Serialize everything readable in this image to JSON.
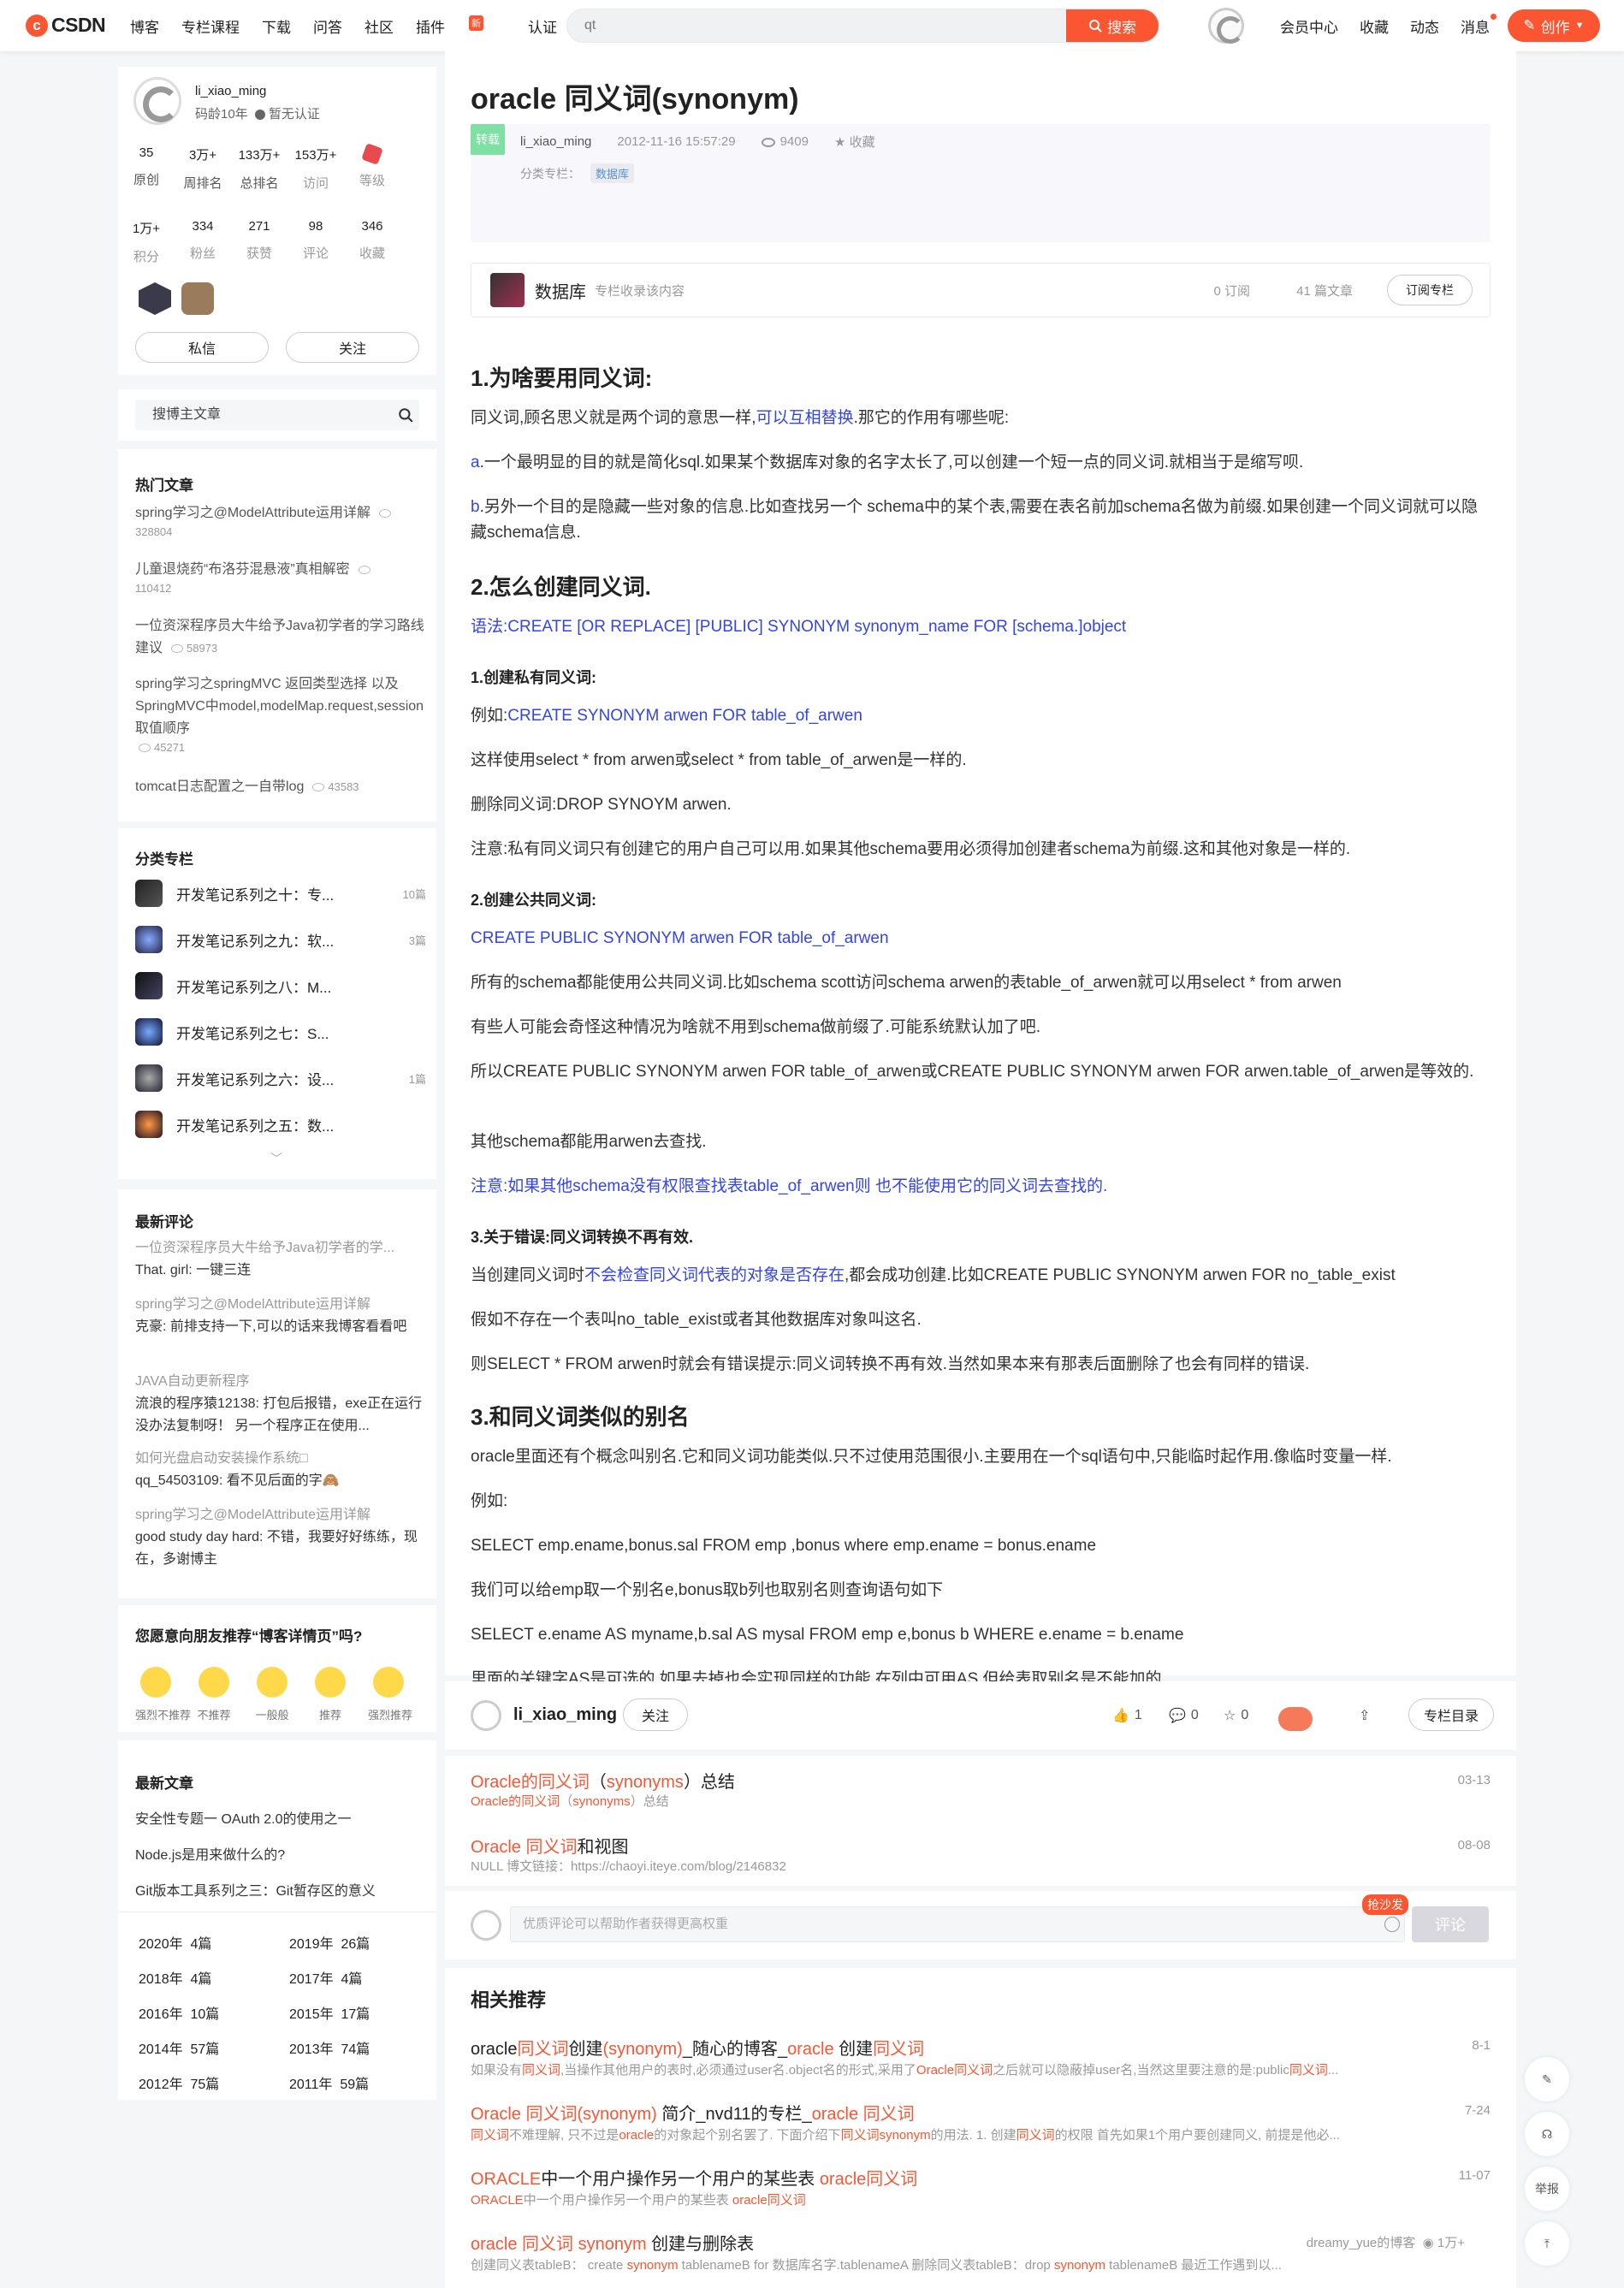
{
  "topbar": {
    "logo": "CSDN",
    "nav": [
      "博客",
      "专栏课程",
      "下载",
      "问答",
      "社区",
      "插件",
      "认证"
    ],
    "plugin_badge": "新",
    "search_value": "qt",
    "search_btn": "搜索",
    "right": [
      "会员中心",
      "收藏",
      "动态",
      "消息"
    ],
    "create": "创作"
  },
  "profile": {
    "name": "li_xiao_ming",
    "age": "码龄10年",
    "verify": "暂无认证",
    "stats1": [
      {
        "v": "35",
        "l": "原创"
      },
      {
        "v": "3万+",
        "l": "周排名"
      },
      {
        "v": "133万+",
        "l": "总排名"
      },
      {
        "v": "153万+",
        "l": "访问"
      },
      {
        "v": "",
        "l": "等级"
      }
    ],
    "stats2": [
      {
        "v": "1万+",
        "l": "积分"
      },
      {
        "v": "334",
        "l": "粉丝"
      },
      {
        "v": "271",
        "l": "获赞"
      },
      {
        "v": "98",
        "l": "评论"
      },
      {
        "v": "346",
        "l": "收藏"
      }
    ],
    "msg": "私信",
    "follow": "关注"
  },
  "sidesearch": {
    "placeholder": "搜博主文章"
  },
  "hot": {
    "title": "热门文章",
    "items": [
      {
        "t": "spring学习之@ModelAttribute运用详解",
        "v": "328804"
      },
      {
        "t": "儿童退烧药“布洛芬混悬液”真相解密",
        "v": "110412"
      },
      {
        "t": "一位资深程序员大牛给予Java初学者的学习路线建议",
        "v": "58973"
      },
      {
        "t": "spring学习之springMVC 返回类型选择 以及 SpringMVC中model,modelMap.request,session取值顺序",
        "v": "45271"
      },
      {
        "t": "tomcat日志配置之一自带log",
        "v": "43583"
      }
    ]
  },
  "columns": {
    "title": "分类专栏",
    "items": [
      {
        "n": "开发笔记系列之十：专...",
        "c": "10篇"
      },
      {
        "n": "开发笔记系列之九：软...",
        "c": "3篇"
      },
      {
        "n": "开发笔记系列之八：M...",
        "c": ""
      },
      {
        "n": "开发笔记系列之七：S...",
        "c": ""
      },
      {
        "n": "开发笔记系列之六：设...",
        "c": "1篇"
      },
      {
        "n": "开发笔记系列之五：数...",
        "c": ""
      }
    ]
  },
  "comments": {
    "title": "最新评论",
    "items": [
      {
        "a": "一位资深程序员大牛给予Java初学者的学...",
        "b": "That. girl: 一键三连"
      },
      {
        "a": "spring学习之@ModelAttribute运用详解",
        "b": "克豪: 前排支持一下,可以的话来我博客看看吧"
      },
      {
        "a": "JAVA自动更新程序",
        "b": "流浪的程序猿12138: 打包后报错，exe正在运行没办法复制呀！ 另一个程序正在使用..."
      },
      {
        "a": "如何光盘启动安装操作系统□",
        "b": "qq_54503109: 看不见后面的字🙈"
      },
      {
        "a": "spring学习之@ModelAttribute运用详解",
        "b": "good study day hard: 不错，我要好好练练，现在，多谢博主"
      }
    ]
  },
  "recommend": {
    "title": "您愿意向朋友推荐“博客详情页”吗?",
    "faces": [
      "强烈不推荐",
      "不推荐",
      "一般般",
      "推荐",
      "强烈推荐"
    ]
  },
  "latest": {
    "title": "最新文章",
    "items": [
      "安全性专题一 OAuth 2.0的使用之一",
      "Node.js是用来做什么的?",
      "Git版本工具系列之三：Git暂存区的意义"
    ]
  },
  "archive": [
    {
      "y": "2020年",
      "c": "4篇"
    },
    {
      "y": "2019年",
      "c": "26篇"
    },
    {
      "y": "2018年",
      "c": "4篇"
    },
    {
      "y": "2017年",
      "c": "4篇"
    },
    {
      "y": "2016年",
      "c": "10篇"
    },
    {
      "y": "2015年",
      "c": "17篇"
    },
    {
      "y": "2014年",
      "c": "57篇"
    },
    {
      "y": "2013年",
      "c": "74篇"
    },
    {
      "y": "2012年",
      "c": "75篇"
    },
    {
      "y": "2011年",
      "c": "59篇"
    }
  ],
  "article": {
    "title": "oracle 同义词(synonym)",
    "tag": "转载",
    "author": "li_xiao_ming",
    "date": "2012-11-16 15:57:29",
    "views": "9409",
    "fav": "收藏",
    "cat_label": "分类专栏：",
    "cat": "数据库",
    "column": {
      "name": "数据库",
      "desc": "专栏收录该内容",
      "subs": "0 订阅",
      "count": "41 篇文章",
      "btn": "订阅专栏"
    }
  },
  "content": {
    "h1": "1.为啥要用同义词:",
    "p1a": "同义词,顾名思义就是两个词的意思一样,",
    "p1b": "可以互相替换",
    "p1c": ".那它的作用有哪些呢:",
    "p2a": "a",
    "p2b": ".一个最明显的目的就是简化sql.如果某个数据库对象的名字太长了,可以创建一个短一点的同义词.就相当于是缩写呗.",
    "p3a": "b",
    "p3b": ".另外一个目的是隐藏一些对象的信息.比如查找另一个 schema中的某个表,需要在表名前加schema名做为前缀.如果创建一个同义词就可以隐藏schema信息.",
    "h2": "2.怎么创建同义词.",
    "p4": "语法:CREATE [OR REPLACE] [PUBLIC] SYNONYM synonym_name FOR [schema.]object",
    "h3": "1.创建私有同义词:",
    "p5a": "例如:",
    "p5b": "CREATE SYNONYM arwen FOR table_of_arwen",
    "p6": "这样使用select * from arwen或select * from table_of_arwen是一样的.",
    "p7": "删除同义词:DROP SYNOYM arwen.",
    "p8": "注意:私有同义词只有创建它的用户自己可以用.如果其他schema要用必须得加创建者schema为前缀.这和其他对象是一样的.",
    "h4": "2.创建公共同义词:",
    "p9": "CREATE PUBLIC SYNONYM arwen FOR table_of_arwen",
    "p10": "所有的schema都能使用公共同义词.比如schema scott访问schema arwen的表table_of_arwen就可以用select * from arwen",
    "p11": "有些人可能会奇怪这种情况为啥就不用到schema做前缀了.可能系统默认加了吧.",
    "p12": "所以CREATE PUBLIC SYNONYM arwen FOR table_of_arwen或CREATE PUBLIC SYNONYM arwen FOR arwen.table_of_arwen是等效的.",
    "p13": "其他schema都能用arwen去查找.",
    "p14": "注意:如果其他schema没有权限查找表table_of_arwen则 也不能使用它的同义词去查找的.",
    "h5": "3.关于错误:同义词转换不再有效.",
    "p15a": "当创建同义词时",
    "p15b": "不会检查同义词代表的对象是否存在",
    "p15c": ",都会成功创建.比如CREATE PUBLIC SYNONYM arwen FOR no_table_exist",
    "p16": "假如不存在一个表叫no_table_exist或者其他数据库对象叫这名.",
    "p17": "则SELECT * FROM arwen时就会有错误提示:同义词转换不再有效.当然如果本来有那表后面删除了也会有同样的错误.",
    "h6": "3.和同义词类似的别名",
    "p18": "oracle里面还有个概念叫别名.它和同义词功能类似.只不过使用范围很小.主要用在一个sql语句中,只能临时起作用.像临时变量一样.",
    "p19": "例如:",
    "p20": "SELECT emp.ename,bonus.sal FROM emp ,bonus  where emp.ename = bonus.ename",
    "p21": "我们可以给emp取一个别名e,bonus取b列也取别名则查询语句如下",
    "p22": "SELECT e.ename AS myname,b.sal AS mysal FROM emp  e,bonus  b WHERE e.ename = b.ename",
    "p23": "里面的关键字AS是可选的,如果去掉也会实现同样的功能.在列中可用AS,但给表取别名是不能加的."
  },
  "authorbar": {
    "name": "li_xiao_ming",
    "follow": "关注",
    "likes": "1",
    "comments": "0",
    "stars": "0",
    "menu": "专栏目录"
  },
  "rec": [
    {
      "t1": "Oracle的",
      "t2": "同义词",
      "t3": "（",
      "t4": "synonyms",
      "t5": "）总结",
      "d1": "Oracle的",
      "d2": "同义词",
      "d3": "（",
      "d4": "synonyms",
      "d5": "）总结",
      "date": "03-13"
    },
    {
      "t1": "Oracle ",
      "t2": "同义词",
      "t3": "和视图",
      "d": "NULL 博文链接：https://chaoyi.iteye.com/blog/2146832",
      "date": "08-08"
    }
  ],
  "comment": {
    "placeholder": "优质评论可以帮助作者获得更高权重",
    "sofa": "抢沙发",
    "btn": "评论"
  },
  "related": {
    "title": "相关推荐",
    "items": [
      {
        "t": [
          [
            "oracle",
            0
          ],
          [
            "同义词",
            1
          ],
          [
            "创建",
            0
          ],
          [
            "(synonym)",
            1
          ],
          [
            "_随心的博客_",
            0
          ],
          [
            "oracle",
            1
          ],
          [
            " 创建",
            0
          ],
          [
            "同义词",
            1
          ]
        ],
        "d": [
          [
            "如果没有",
            0
          ],
          [
            "同义词",
            1
          ],
          [
            ",当操作其他用户的表时,必须通过user名.object名的形式,采用了",
            0
          ],
          [
            "Oracle同义词",
            1
          ],
          [
            "之后就可以隐蔽掉user名,当然这里要注意的是:public",
            0
          ],
          [
            "同义词",
            1
          ],
          [
            "...",
            0
          ]
        ],
        "date": "8-1"
      },
      {
        "t": [
          [
            "Oracle ",
            1
          ],
          [
            "同义词",
            1
          ],
          [
            "(synonym)",
            1
          ],
          [
            " 简介_nvd11的专栏_",
            0
          ],
          [
            "oracle ",
            1
          ],
          [
            "同义词",
            1
          ]
        ],
        "d": [
          [
            "同义词",
            1
          ],
          [
            "不难理解, 只不过是",
            0
          ],
          [
            "oracle",
            1
          ],
          [
            "的对象起个别名罢了. 下面介绍下",
            0
          ],
          [
            "同义词synonym",
            1
          ],
          [
            "的用法. 1. 创建",
            0
          ],
          [
            "同义词",
            1
          ],
          [
            "的权限 首先如果1个用户要创建同义, 前提是他必...",
            0
          ]
        ],
        "date": "7-24"
      },
      {
        "t": [
          [
            "ORACLE",
            1
          ],
          [
            "中一个用户操作另一个用户的某些表 ",
            0
          ],
          [
            "oracle同义词",
            1
          ]
        ],
        "d": [
          [
            "ORACLE",
            1
          ],
          [
            "中一个用户操作另一个用户的某些表 ",
            0
          ],
          [
            "oracle同义词",
            1
          ]
        ],
        "date": "11-07"
      },
      {
        "t": [
          [
            "oracle ",
            1
          ],
          [
            "同义词",
            1
          ],
          [
            " synonym",
            1
          ],
          [
            " 创建与删除表",
            0
          ]
        ],
        "d": [
          [
            "创建同义表tableB：  create ",
            0
          ],
          [
            "synonym",
            1
          ],
          [
            " tablenameB for 数据库名字.tablenameA        删除同义表tableB：drop ",
            0
          ],
          [
            "synonym",
            1
          ],
          [
            " tablenameB        最近工作遇到以...",
            0
          ]
        ],
        "date": "",
        "author": "dreamy_yue的博客",
        "v": "1万+"
      }
    ]
  },
  "sidebtns": [
    "",
    "",
    "举报",
    ""
  ]
}
